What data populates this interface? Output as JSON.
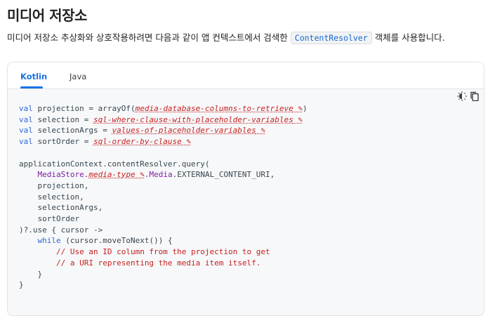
{
  "page": {
    "title": "미디어 저장소",
    "intro_text": "미디어 저장소 추상화와 상호작용하려면 다음과 같이 앱 컨텍스트에서 검색한",
    "intro_code": "ContentResolver",
    "intro_suffix": "객체를 사용합니다."
  },
  "tabs": [
    {
      "label": "Kotlin",
      "active": true
    },
    {
      "label": "Java",
      "active": false
    }
  ],
  "toolbar": {
    "theme_icon": "brightness-icon",
    "copy_icon": "copy-icon"
  },
  "code": {
    "l1_kw": "val",
    "l1_pre": " projection = arrayOf(",
    "l1_ph": "media-database-columns-to-retrieve",
    "l1_post": ")",
    "l2_kw": "val",
    "l2_pre": " selection = ",
    "l2_ph": "sql-where-clause-with-placeholder-variables",
    "l3_kw": "val",
    "l3_pre": " selectionArgs = ",
    "l3_ph": "values-of-placeholder-variables",
    "l4_kw": "val",
    "l4_pre": " sortOrder = ",
    "l4_ph": "sql-order-by-clause",
    "l6": "applicationContext.contentResolver.query(",
    "l7_cls": "MediaStore.",
    "l7_ph": "media-type",
    "l7_media": ".Media",
    "l7_post": ".EXTERNAL_CONTENT_URI,",
    "l8": "projection,",
    "l9": "selection,",
    "l10": "selectionArgs,",
    "l11": "sortOrder",
    "l12": ")?.use { cursor ->",
    "l13_kw": "while",
    "l13_post": " (cursor.moveToNext()) {",
    "l14": "// Use an ID column from the projection to get",
    "l15": "// a URI representing the media item itself.",
    "l16": "}",
    "l17": "}"
  }
}
